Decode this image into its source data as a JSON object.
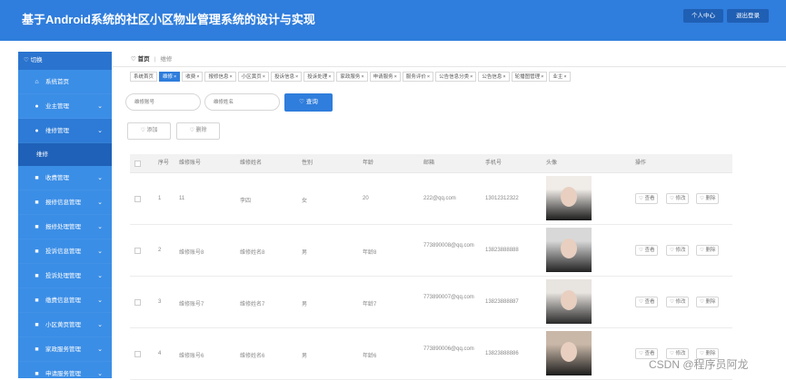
{
  "header": {
    "title": "基于Android系统的社区小区物业管理系统的设计与实现",
    "btn_profile": "个人中心",
    "btn_logout": "退出登录"
  },
  "sidebar": {
    "switch_label": "切换",
    "items": [
      {
        "label": "系统首页",
        "icon": "home-icon",
        "chevron": false
      },
      {
        "label": "业主管理",
        "icon": "user-icon",
        "chevron": true
      },
      {
        "label": "维修管理",
        "icon": "user-icon",
        "chevron": true,
        "active": true
      },
      {
        "label": "收费管理",
        "icon": "grid-icon",
        "chevron": true
      },
      {
        "label": "报修信息管理",
        "icon": "grid-icon",
        "chevron": true
      },
      {
        "label": "报修处理管理",
        "icon": "grid-icon",
        "chevron": true
      },
      {
        "label": "投诉信息管理",
        "icon": "grid-icon",
        "chevron": true
      },
      {
        "label": "投诉处理管理",
        "icon": "grid-icon",
        "chevron": true
      },
      {
        "label": "缴费信息管理",
        "icon": "grid-icon",
        "chevron": true
      },
      {
        "label": "小区黄页管理",
        "icon": "grid-icon",
        "chevron": true
      },
      {
        "label": "家政服务管理",
        "icon": "grid-icon",
        "chevron": true
      },
      {
        "label": "申请服务管理",
        "icon": "grid-icon",
        "chevron": true
      }
    ],
    "submenu_label": "维修"
  },
  "breadcrumb": {
    "home": "首页",
    "current": "维修"
  },
  "tabs": [
    "系统首页",
    "维修",
    "收费",
    "报修信息",
    "小区黄页",
    "投诉信息",
    "投诉处理",
    "家政服务",
    "申请服务",
    "服务评价",
    "公告信息分类",
    "公告信息",
    "轮播图管理",
    "业主"
  ],
  "active_tab": 1,
  "search": {
    "account_placeholder": "维修账号",
    "name_placeholder": "维修姓名",
    "button": "查询"
  },
  "actions": {
    "add": "添加",
    "delete": "删除"
  },
  "table": {
    "headers": [
      "序号",
      "维修账号",
      "维修姓名",
      "性别",
      "年龄",
      "邮箱",
      "手机号",
      "头像",
      "操作"
    ],
    "rows": [
      {
        "no": "1",
        "account": "11",
        "name": "李四",
        "gender": "女",
        "age": "20",
        "email": "222@qq.com",
        "phone": "13012312322",
        "photo_colors": [
          "#f0ece8",
          "#1a1a1a"
        ]
      },
      {
        "no": "2",
        "account": "维修账号8",
        "name": "维修姓名8",
        "gender": "男",
        "age": "年龄8",
        "email": "773890008@qq.com",
        "phone": "13823888888",
        "photo_colors": [
          "#d8d8d8",
          "#222222"
        ]
      },
      {
        "no": "3",
        "account": "维修账号7",
        "name": "维修姓名7",
        "gender": "男",
        "age": "年龄7",
        "email": "773890007@qq.com",
        "phone": "13823888887",
        "photo_colors": [
          "#e8e4e0",
          "#2a2a2a"
        ]
      },
      {
        "no": "4",
        "account": "维修账号6",
        "name": "维修姓名6",
        "gender": "男",
        "age": "年龄6",
        "email": "773890006@qq.com",
        "phone": "13823888886",
        "photo_colors": [
          "#c9b8a8",
          "#1c1c1c"
        ]
      }
    ],
    "op_view": "查看",
    "op_edit": "修改",
    "op_delete": "删除"
  },
  "watermark": "CSDN @程序员阿龙",
  "colors": {
    "primary": "#2f7ddc",
    "sidebar": "#3b8ee6",
    "sidebar_dark": "#1f61b8"
  }
}
